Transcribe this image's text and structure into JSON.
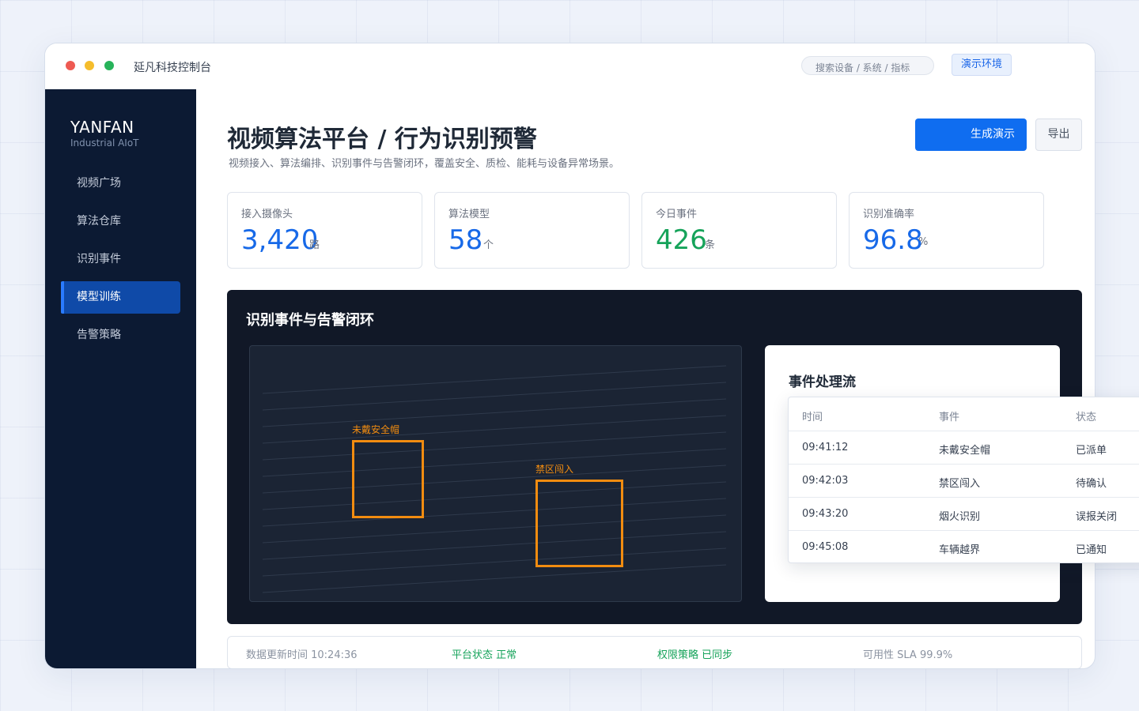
{
  "window": {
    "title": "延凡科技控制台",
    "search_placeholder": "搜索设备 / 系统 / 指标",
    "env_label": "演示环境"
  },
  "sidebar": {
    "brand": "YANFAN",
    "brand_sub": "Industrial AIoT",
    "items": [
      {
        "label": "视频广场"
      },
      {
        "label": "算法仓库"
      },
      {
        "label": "识别事件"
      },
      {
        "label": "模型训练",
        "active": true
      },
      {
        "label": "告警策略"
      }
    ]
  },
  "header": {
    "title": "视频算法平台 / 行为识别预警",
    "subtitle": "视频接入、算法编排、识别事件与告警闭环，覆盖安全、质检、能耗与设备异常场景。",
    "primary_button": "生成演示",
    "secondary_button": "导出"
  },
  "kpis": [
    {
      "label": "接入摄像头",
      "value": "3,420",
      "unit": "路",
      "color": "#1769e8"
    },
    {
      "label": "算法模型",
      "value": "58",
      "unit": "个",
      "color": "#1769e8"
    },
    {
      "label": "今日事件",
      "value": "426",
      "unit": "条",
      "color": "#16a35a"
    },
    {
      "label": "识别准确率",
      "value": "96.8",
      "unit": "%",
      "color": "#1769e8"
    }
  ],
  "panel": {
    "title": "识别事件与告警闭环",
    "detections": [
      {
        "label": "未戴安全帽"
      },
      {
        "label": "禁区闯入"
      }
    ],
    "detection_color": "#f28c10",
    "event_flow_title": "事件处理流"
  },
  "event_table": {
    "columns": [
      "时间",
      "事件",
      "状态"
    ],
    "rows": [
      {
        "time": "09:41:12",
        "event": "未戴安全帽",
        "status": "已派单"
      },
      {
        "time": "09:42:03",
        "event": "禁区闯入",
        "status": "待确认"
      },
      {
        "time": "09:43:20",
        "event": "烟火识别",
        "status": "误报关闭"
      },
      {
        "time": "09:45:08",
        "event": "车辆越界",
        "status": "已通知"
      }
    ]
  },
  "footer": {
    "updated": "数据更新时间 10:24:36",
    "platform_status": "平台状态 正常",
    "permission": "权限策略 已同步",
    "sla": "可用性 SLA 99.9%"
  }
}
